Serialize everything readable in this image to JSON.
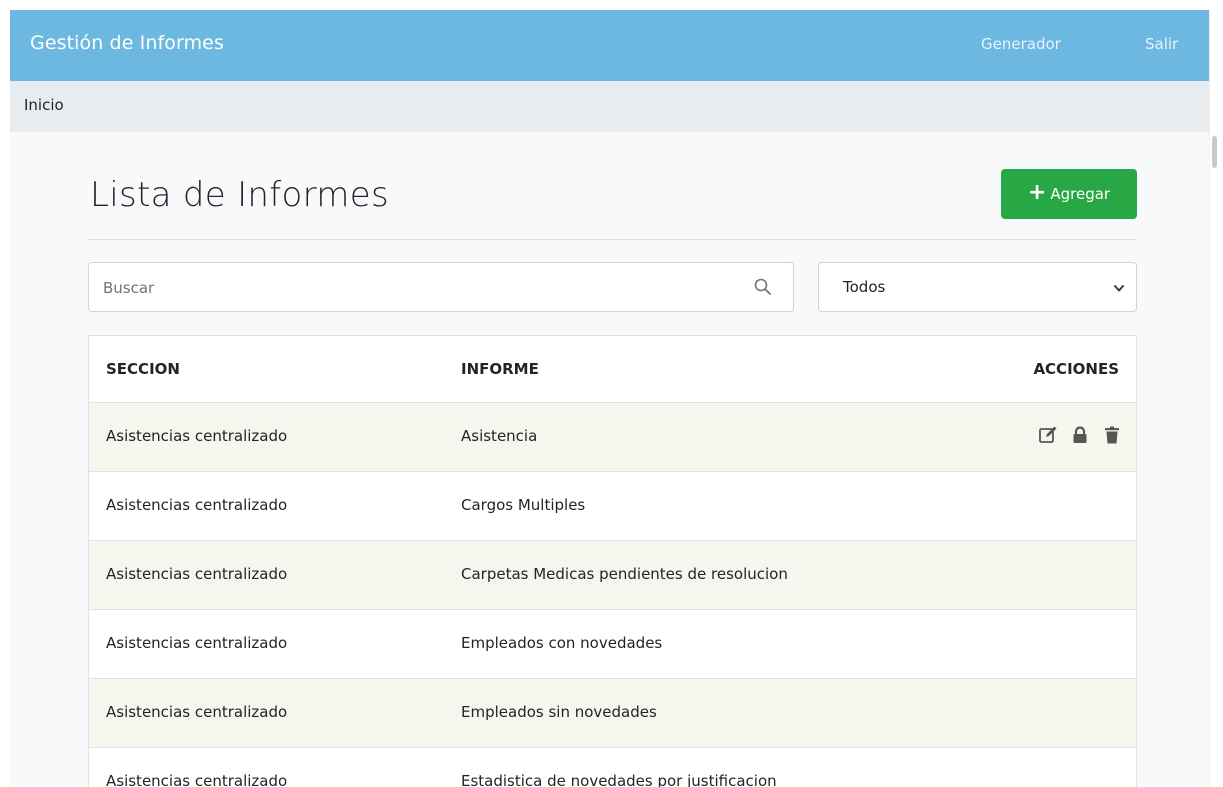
{
  "navbar": {
    "brand": "Gestión de Informes",
    "links": [
      "Generador",
      "Salir"
    ]
  },
  "breadcrumb": {
    "current": "Inicio"
  },
  "header": {
    "title": "Lista de Informes",
    "add_label": "Agregar",
    "add_icon": "plus-icon",
    "add_color": "#28a745"
  },
  "filters": {
    "search_placeholder": "Buscar",
    "search_value": "",
    "select_value": "Todos"
  },
  "table": {
    "columns": [
      "SECCION",
      "INFORME",
      "ACCIONES"
    ],
    "rows": [
      {
        "seccion": "Asistencias centralizado",
        "informe": "Asistencia"
      },
      {
        "seccion": "Asistencias centralizado",
        "informe": "Cargos Multiples"
      },
      {
        "seccion": "Asistencias centralizado",
        "informe": "Carpetas Medicas pendientes de resolucion"
      },
      {
        "seccion": "Asistencias centralizado",
        "informe": "Empleados con novedades"
      },
      {
        "seccion": "Asistencias centralizado",
        "informe": "Empleados sin novedades"
      },
      {
        "seccion": "Asistencias centralizado",
        "informe": "Estadistica de novedades por justificacion"
      }
    ],
    "action_icons": [
      "edit-icon",
      "lock-icon",
      "trash-icon"
    ],
    "stripe_color": "#f6f5ee"
  },
  "colors": {
    "navbar": "#6cb8e0",
    "breadcrumb_bg": "#e9ecef"
  }
}
